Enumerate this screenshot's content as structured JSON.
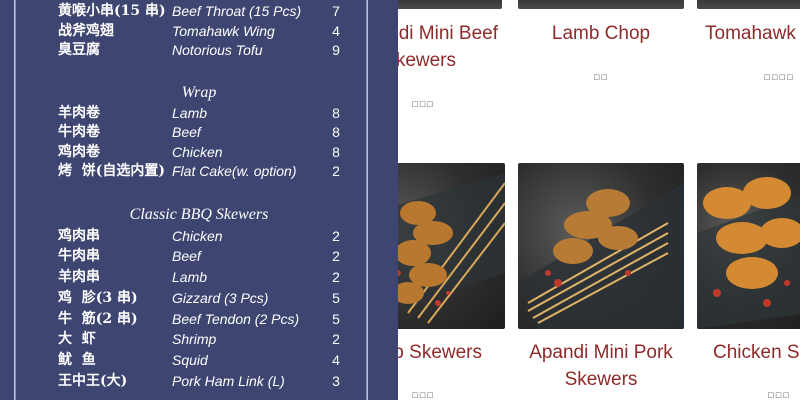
{
  "menu": {
    "group_top": [
      {
        "zh": "黄喉小串(15 串)",
        "en": "Beef Throat (15 Pcs)",
        "price": "7"
      },
      {
        "zh": "战斧鸡翅",
        "en": "Tomahawk Wing",
        "price": "4"
      },
      {
        "zh": "臭豆腐",
        "en": "Notorious Tofu",
        "price": "9"
      }
    ],
    "wrap_title": "Wrap",
    "wrap": [
      {
        "zh": "羊肉卷",
        "en": "Lamb",
        "price": "8"
      },
      {
        "zh": "牛肉卷",
        "en": "Beef",
        "price": "8"
      },
      {
        "zh": "鸡肉卷",
        "en": "Chicken",
        "price": "8"
      },
      {
        "zh": "烤  饼(自选内置)",
        "en": "Flat Cake(w. option)",
        "price": "2"
      }
    ],
    "skewers_title": "Classic BBQ Skewers",
    "skewers": [
      {
        "zh": "鸡肉串",
        "en": "Chicken",
        "price": "2"
      },
      {
        "zh": "牛肉串",
        "en": "Beef",
        "price": "2"
      },
      {
        "zh": "羊肉串",
        "en": "Lamb",
        "price": "2"
      },
      {
        "zh": "鸡  胗(3 串)",
        "en": "Gizzard (3 Pcs)",
        "price": "5"
      },
      {
        "zh": "牛  筋(2 串)",
        "en": "Beef Tendon (2 Pcs)",
        "price": "5"
      },
      {
        "zh": "大  虾",
        "en": "Shrimp",
        "price": "2"
      },
      {
        "zh": "鱿  鱼",
        "en": "Squid",
        "price": "4"
      },
      {
        "zh": "王中王(大)",
        "en": "Pork Ham Link (L)",
        "price": "3"
      }
    ]
  },
  "products": {
    "row1": [
      {
        "name_line1": "di Mini Beef",
        "name_line2": "kewers",
        "price": "□□□"
      },
      {
        "name_line1": "Lamb Chop",
        "name_line2": "",
        "price": "□□"
      },
      {
        "name_line1": "Tomahawk",
        "name_line2": "",
        "price": "□□□□"
      }
    ],
    "row2": [
      {
        "name_line1": "b Skewers",
        "name_line2": "",
        "price": "□□□"
      },
      {
        "name_line1": "Apandi Mini Pork",
        "name_line2": "Skewers",
        "price": ""
      },
      {
        "name_line1": "Chicken Sk",
        "name_line2": "",
        "price": "□□□"
      }
    ]
  },
  "colors": {
    "menu_background": "#3d4570",
    "menu_text": "#ffffff",
    "product_name": "#8e2a2a"
  }
}
